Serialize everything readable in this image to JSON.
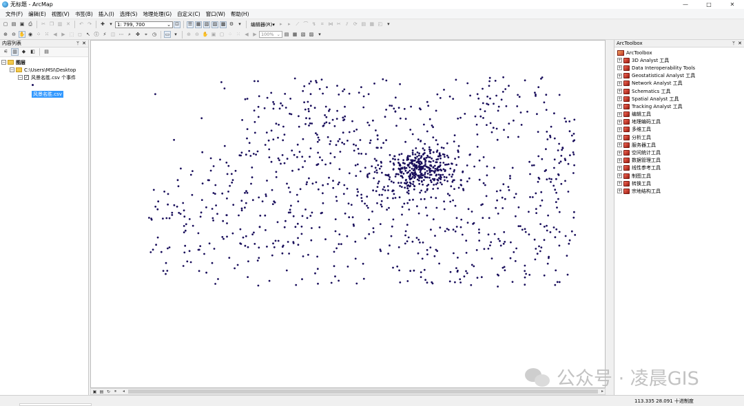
{
  "window": {
    "title": "无标题 - ArcMap",
    "controls": [
      "—",
      "□",
      "✕"
    ]
  },
  "menubar": [
    "文件(F)",
    "编辑(E)",
    "视图(V)",
    "书签(B)",
    "插入(I)",
    "选择(S)",
    "地理处理(G)",
    "自定义(C)",
    "窗口(W)",
    "帮助(H)"
  ],
  "toolbar": {
    "scale": "1: 799, 700",
    "editor_label": "编辑器(R)▾",
    "zoom_level": "100%"
  },
  "toc": {
    "title": "内容列表",
    "root_label": "图层",
    "folder_path": "C:\\Users\\MSI\\Desktop",
    "layer_label": "风景名胜.csv 个事件",
    "table_label": "风景名胜.csv"
  },
  "toolbox": {
    "title": "ArcToolbox",
    "root": "ArcToolbox",
    "items": [
      "3D Analyst 工具",
      "Data Interoperability Tools",
      "Geostatistical Analyst 工具",
      "Network Analyst 工具",
      "Schematics 工具",
      "Spatial Analyst 工具",
      "Tracking Analyst 工具",
      "编辑工具",
      "地理编码工具",
      "多维工具",
      "分析工具",
      "服务器工具",
      "空间统计工具",
      "数据管理工具",
      "线性参考工具",
      "制图工具",
      "转换工具",
      "宗地结构工具"
    ]
  },
  "status": {
    "coords": "113.335  28.091  十进制度"
  },
  "watermark": {
    "text": "公众号 · 凌晨GIS"
  },
  "colors": {
    "point": "#1a0f5c",
    "selection": "#3399ff",
    "toolbox_icon": "#c0392b"
  },
  "chart_data": {
    "type": "scatter",
    "xlim": [
      109.0,
      115.2
    ],
    "ylim": [
      24.6,
      30.3
    ],
    "clusters": [
      {
        "cx": 112.98,
        "cy": 28.19,
        "sx": 0.22,
        "sy": 0.18,
        "n": 360
      },
      {
        "cx": 112.6,
        "cy": 28.0,
        "sx": 1.1,
        "sy": 0.9,
        "n": 520
      },
      {
        "cx": 110.4,
        "cy": 27.2,
        "sx": 0.75,
        "sy": 0.6,
        "n": 180
      },
      {
        "cx": 113.6,
        "cy": 26.3,
        "sx": 0.35,
        "sy": 0.4,
        "n": 60
      },
      {
        "cx": 114.55,
        "cy": 27.2,
        "sx": 0.4,
        "sy": 0.8,
        "n": 120
      },
      {
        "cx": 114.85,
        "cy": 28.6,
        "sx": 0.25,
        "sy": 0.5,
        "n": 90
      },
      {
        "cx": 113.9,
        "cy": 29.3,
        "sx": 0.28,
        "sy": 0.4,
        "n": 55
      },
      {
        "cx": 111.7,
        "cy": 29.0,
        "sx": 0.55,
        "sy": 0.5,
        "n": 110
      }
    ]
  }
}
